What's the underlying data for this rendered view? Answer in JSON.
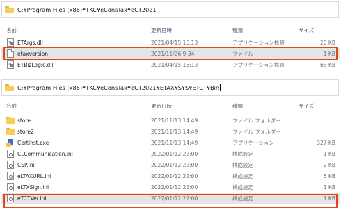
{
  "panel1": {
    "address": "C:¥Program Files (x86)¥TKC¥eConsTax¥eCT2021",
    "columns": {
      "name": "名前",
      "date": "更新日時",
      "type": "種類",
      "size": "サイズ"
    },
    "files": [
      {
        "name": "ETArgs.dll",
        "date": "2021/04/15 16:13",
        "type": "アプリケーション拡張",
        "size": "20 KB",
        "icon": "dll-icon"
      },
      {
        "name": "etaxversion",
        "date": "2021/11/26 9:34",
        "type": "ファイル",
        "size": "1 KB",
        "icon": "file-icon"
      },
      {
        "name": "ETBizLogic.dll",
        "date": "2021/04/15 16:13",
        "type": "アプリケーション拡張",
        "size": "68 KB",
        "icon": "dll-icon"
      }
    ]
  },
  "panel2": {
    "address": "C:¥Program Files (x86)¥TKC¥eConsTax¥eCT2021¥ETAX¥SYS¥ETCT¥Bin",
    "columns": {
      "name": "名前",
      "date": "更新日時",
      "type": "種類",
      "size": "サイズ"
    },
    "files": [
      {
        "name": "store",
        "date": "2021/11/13 14:49",
        "type": "ファイル フォルダー",
        "size": "",
        "icon": "folder-icon"
      },
      {
        "name": "store2",
        "date": "2021/11/13 14:49",
        "type": "ファイル フォルダー",
        "size": "",
        "icon": "folder-icon"
      },
      {
        "name": "CertInst.exe",
        "date": "2021/11/13 14:49",
        "type": "アプリケーション",
        "size": "327 KB",
        "icon": "exe-icon"
      },
      {
        "name": "CLCommunication.ini",
        "date": "2022/01/12 22:00",
        "type": "構成設定",
        "size": "1 KB",
        "icon": "ini-icon"
      },
      {
        "name": "CSP.ini",
        "date": "2022/01/12 22:00",
        "type": "構成設定",
        "size": "2 KB",
        "icon": "ini-icon"
      },
      {
        "name": "eLTAXURL.ini",
        "date": "2022/01/12 22:00",
        "type": "構成設定",
        "size": "5 KB",
        "icon": "ini-icon"
      },
      {
        "name": "eLTXSign.ini",
        "date": "2022/01/12 22:00",
        "type": "構成設定",
        "size": "1 KB",
        "icon": "ini-icon"
      },
      {
        "name": "eTCTVer.ini",
        "date": "2022/01/12 22:00",
        "type": "構成設定",
        "size": "1 KB",
        "icon": "ini-icon"
      }
    ]
  },
  "colors": {
    "highlight": "#e2461f",
    "selection": "#e5e5e5",
    "folder": "#f7cf57",
    "header_text": "#4c607a"
  }
}
